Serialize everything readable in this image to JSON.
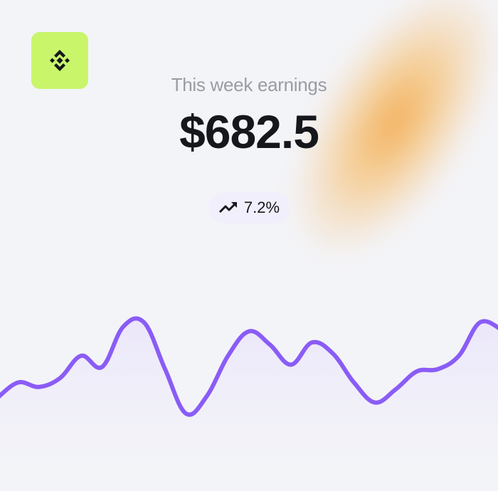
{
  "earnings": {
    "label": "This week earnings",
    "amount": "$682.5",
    "change": "7.2%"
  },
  "icons": {
    "logo": "binance-logo-icon",
    "trend": "trending-up-icon"
  },
  "colors": {
    "logo_bg": "#c9f56b",
    "line": "#8a5cf6",
    "area": "#ebe6fb",
    "glow": "#f2aa50"
  },
  "chart_data": {
    "type": "area",
    "x": [
      0,
      1,
      2,
      3,
      4,
      5,
      6,
      7,
      8,
      9,
      10,
      11,
      12,
      13,
      14,
      15,
      16,
      17,
      18,
      19,
      20,
      21,
      22,
      23,
      24
    ],
    "values": [
      58,
      72,
      68,
      76,
      96,
      86,
      122,
      126,
      84,
      44,
      60,
      96,
      118,
      106,
      88,
      108,
      98,
      72,
      54,
      66,
      82,
      84,
      96,
      126,
      120
    ],
    "ylim": [
      0,
      160
    ],
    "grid": false
  }
}
